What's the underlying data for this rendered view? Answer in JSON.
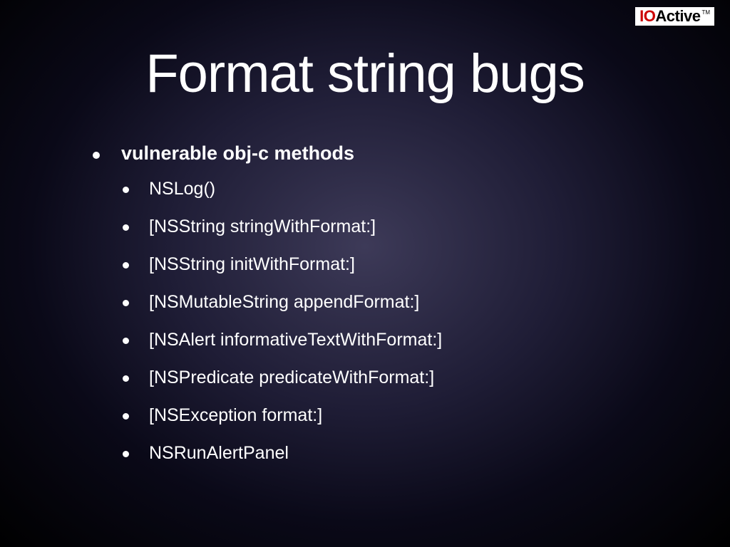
{
  "logo": {
    "io": "IO",
    "active": "Active",
    "tm": "TM"
  },
  "title": "Format string bugs",
  "main_bullet": "vulnerable obj-c methods",
  "sub_bullets": [
    "NSLog()",
    "[NSString stringWithFormat:]",
    "[NSString initWithFormat:]",
    "[NSMutableString appendFormat:]",
    "[NSAlert informativeTextWithFormat:]",
    "[NSPredicate predicateWithFormat:]",
    "[NSException format:]",
    "NSRunAlertPanel"
  ]
}
